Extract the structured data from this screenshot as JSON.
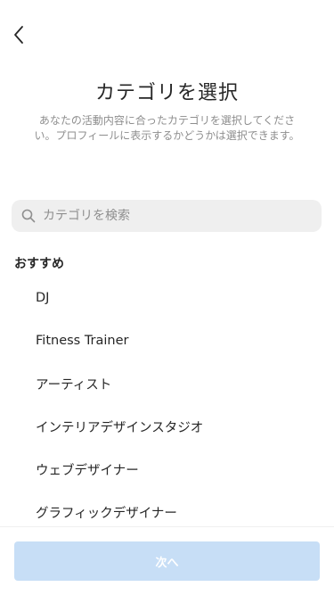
{
  "header": {
    "back_icon": "chevron-left-icon",
    "title": "カテゴリを選択",
    "subtitle": "あなたの活動内容に合ったカテゴリを選択してください。プロフィールに表示するかどうかは選択できます。"
  },
  "search": {
    "icon": "search-icon",
    "placeholder": "カテゴリを検索",
    "value": ""
  },
  "section": {
    "label": "おすすめ"
  },
  "categories": [
    {
      "label": "DJ"
    },
    {
      "label": "Fitness Trainer"
    },
    {
      "label": "アーティスト"
    },
    {
      "label": "インテリアデザインスタジオ"
    },
    {
      "label": "ウェブデザイナー"
    },
    {
      "label": "グラフィックデザイナー"
    }
  ],
  "footer": {
    "next_label": "次へ"
  },
  "colors": {
    "primary_disabled": "#c7def6",
    "text": "#262626",
    "muted": "#8e8e8e",
    "search_bg": "#efefef"
  }
}
